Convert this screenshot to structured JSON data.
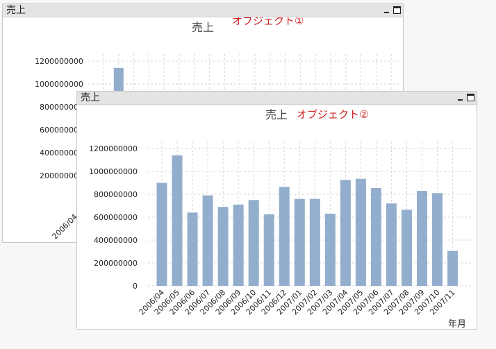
{
  "window1": {
    "title": "売上",
    "overlay_label": "オブジェクト①",
    "chart_title": "売上",
    "minimize_label": "",
    "maximize_label": ""
  },
  "window2": {
    "title": "売上",
    "overlay_label": "オブジェクト②",
    "chart_title": "売上",
    "xlabel": "年月"
  },
  "colors": {
    "bar": "#93aecd",
    "grid": "#d6d6d6",
    "annotation": "#d21e1e",
    "titlebar": "#e4e4e4"
  },
  "chart_data": [
    {
      "type": "bar",
      "title": "売上",
      "xlabel": "年月",
      "ylabel": "",
      "ylim": [
        0,
        1200000000
      ],
      "yticks": [
        0,
        200000000,
        400000000,
        600000000,
        800000000,
        1000000000,
        1200000000
      ],
      "categories": [
        "2006/04",
        "2006/05",
        "2006/06",
        "2006/07",
        "2006/08",
        "2006/09",
        "2006/10",
        "2006/11",
        "2006/12",
        "2007/01",
        "2007/02",
        "2007/03",
        "2007/04",
        "2007/05",
        "2007/06",
        "2007/07",
        "2007/08",
        "2007/09",
        "2007/10",
        "2007/11"
      ],
      "values": [
        900000000,
        1140000000,
        640000000,
        790000000,
        690000000,
        710000000,
        750000000,
        625000000,
        865000000,
        760000000,
        760000000,
        630000000,
        925000000,
        935000000,
        855000000,
        720000000,
        665000000,
        830000000,
        810000000,
        305000000
      ],
      "grid": true,
      "legend": "none"
    }
  ]
}
